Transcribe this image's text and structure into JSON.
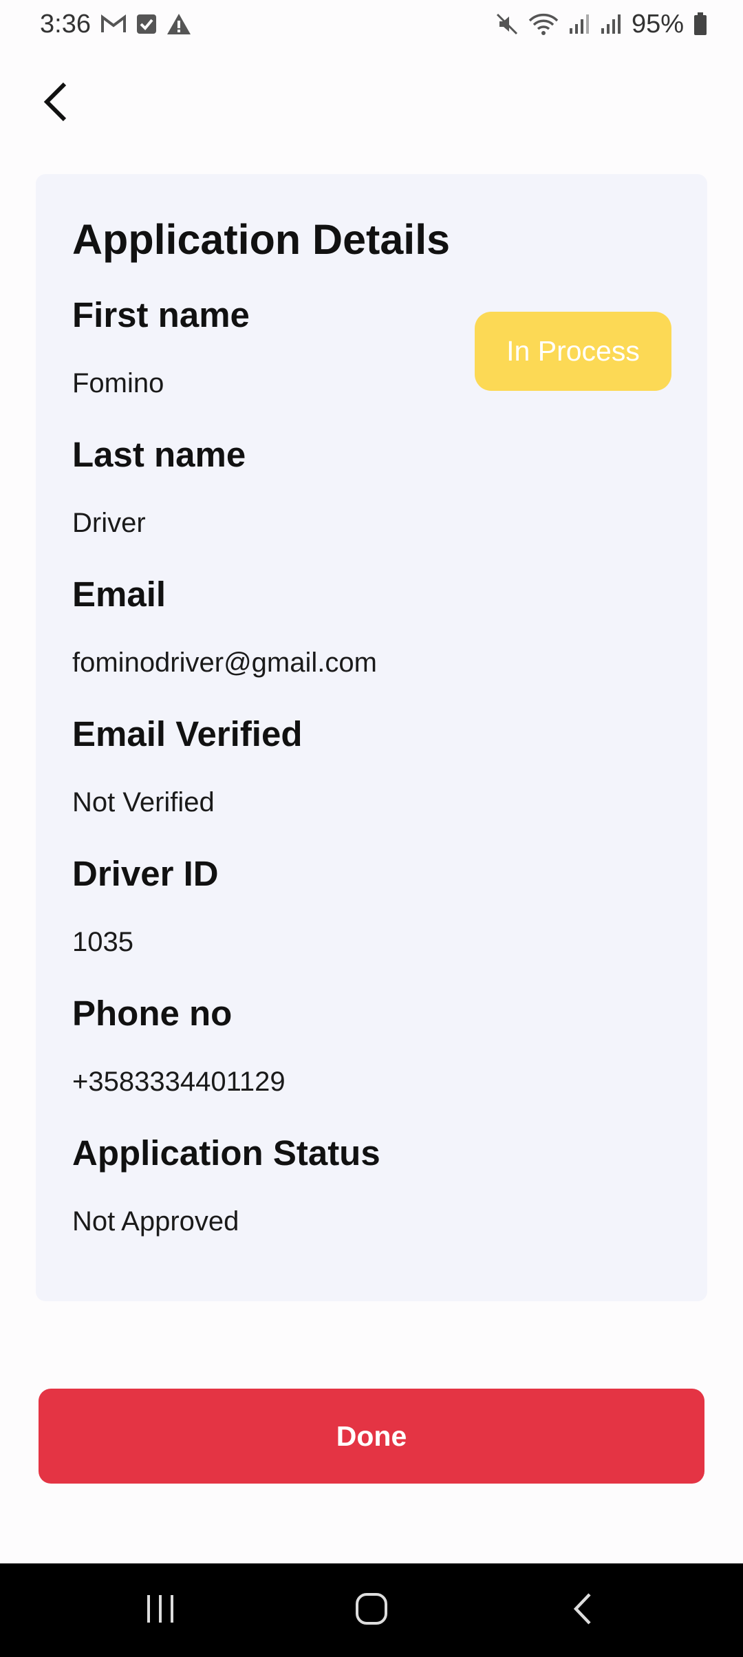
{
  "status_bar": {
    "time": "3:36",
    "battery": "95%",
    "left_icons": [
      "gmail-icon",
      "checkbox-icon",
      "warning-icon"
    ],
    "right_icons": [
      "mute-icon",
      "wifi-icon",
      "signal-icon",
      "signal-icon",
      "battery-icon"
    ]
  },
  "header": {
    "back_icon": "chevron-left-icon"
  },
  "card": {
    "title": "Application Details",
    "badge": "In Process",
    "fields": [
      {
        "label": "First name",
        "value": "Fomino"
      },
      {
        "label": "Last name",
        "value": "Driver"
      },
      {
        "label": "Email",
        "value": "fominodriver@gmail.com"
      },
      {
        "label": "Email Verified",
        "value": "Not Verified"
      },
      {
        "label": "Driver ID",
        "value": "1035"
      },
      {
        "label": "Phone no",
        "value": "+3583334401129"
      },
      {
        "label": "Application Status",
        "value": "Not Approved"
      }
    ]
  },
  "actions": {
    "done_label": "Done"
  },
  "nav_bar": {
    "buttons": [
      "recent-apps-icon",
      "home-icon",
      "back-icon"
    ]
  },
  "colors": {
    "card_bg": "#f3f4fb",
    "badge_bg": "#fcd955",
    "done_bg": "#e43444",
    "nav_bg": "#000000"
  }
}
